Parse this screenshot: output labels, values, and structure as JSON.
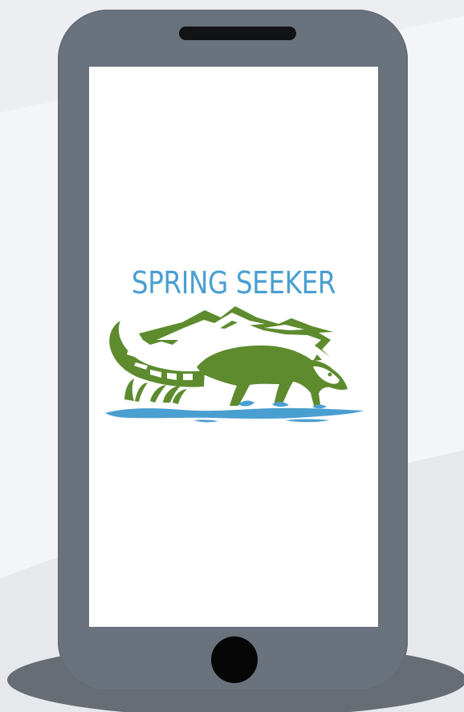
{
  "app": {
    "name": "SPRING SEEKER"
  },
  "colors": {
    "background": "#eceef1",
    "phone_body": "#6a727d",
    "screen": "#ffffff",
    "title": "#4a9fd1",
    "logo_green": "#5d8b2e",
    "water_blue": "#4a9fd1"
  },
  "icons": {
    "home_button": "home-button",
    "speaker": "speaker-slot"
  }
}
